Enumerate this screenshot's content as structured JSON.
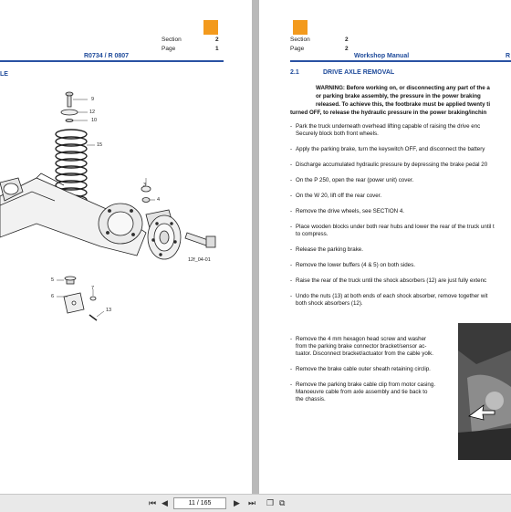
{
  "left_page": {
    "header": {
      "section_label": "Section",
      "section_value": "2",
      "page_label": "Page",
      "page_value": "1",
      "ref": "R0734 / R 0807"
    },
    "title_fragment": "LE",
    "figure": {
      "labels": [
        "9",
        "12",
        "10",
        "15",
        "3",
        "4",
        "5",
        "6",
        "7",
        "13"
      ],
      "caption": "12f_04-01"
    }
  },
  "right_page": {
    "header": {
      "section_label": "Section",
      "section_value": "2",
      "page_label": "Page",
      "page_value": "2",
      "manual": "Workshop Manual",
      "ref_fragment": "R"
    },
    "section_number": "2.1",
    "section_title": "DRIVE AXLE REMOVAL",
    "warning_lines": [
      "WARNING: Before working on, or disconnecting any part of the a",
      "or parking brake assembly, the pressure in the power braking",
      "released. To achieve this, the footbrake must be applied twenty ti",
      "turned OFF, to release the hydraulic pressure in the power braking/inchin"
    ],
    "steps": [
      [
        "Park the truck underneath overhead lifting capable of raising the drive enc",
        "Securely block both front wheels."
      ],
      [
        "Apply the parking brake, turn the keyswitch OFF, and disconnect the battery"
      ],
      [
        "Discharge accumulated hydraulic pressure by depressing the brake pedal 20"
      ],
      [
        "On the P 250, open the rear (power unit) cover."
      ],
      [
        "On the W 20, lift off the rear cover."
      ],
      [
        "Remove the drive wheels, see SECTION 4."
      ],
      [
        "Place wooden blocks under both rear hubs and lower the rear of the truck until t",
        "to compress."
      ],
      [
        "Release the parking brake."
      ],
      [
        "Remove the lower buffers (4 & 5) on both sides."
      ],
      [
        "Raise the rear of the truck until the shock absorbers (12) are just fully extenc"
      ],
      [
        "Undo the nuts (13) at both ends of each shock absorber, remove together wit",
        "both shock absorbers (12)."
      ]
    ],
    "lower_steps": [
      [
        "Remove the 4 mm hexagon head screw and washer",
        "from the parking brake connector bracket/sensor ac-",
        "tuator. Disconnect bracket/actuator from the cable yolk."
      ],
      [
        "Remove the brake cable outer sheath retaining circlip."
      ],
      [
        "Remove the parking brake cable clip from motor casing.",
        "Manoeuvre cable from axle assembly and tie back to",
        "the chassis."
      ]
    ]
  },
  "toolbar": {
    "page_indicator": "11 / 165"
  },
  "colors": {
    "accent_orange": "#f39a1d",
    "header_blue": "#1e4a9a",
    "background_gray": "#b9b9b9"
  }
}
